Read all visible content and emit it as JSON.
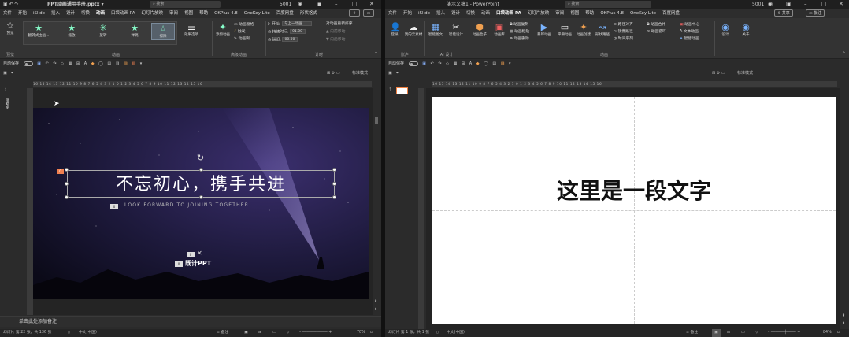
{
  "left": {
    "title": "PPT动画通用手册.pptx ▾",
    "search": "搜索",
    "user": "5001",
    "tabs": [
      "文件",
      "开始",
      "iSlide",
      "插入",
      "设计",
      "切换",
      "动画",
      "口袋动画 PA",
      "幻灯片放映",
      "审阅",
      "视图",
      "帮助",
      "OKPlus 4.8",
      "OneKey Lite",
      "百度网盘",
      "形状格式"
    ],
    "active_tab": 6,
    "ribbon": {
      "preview": "预览",
      "preview_group": "预览",
      "effects": [
        "翻转式由远...",
        "缩放",
        "旋转",
        "弹跳",
        "擦除"
      ],
      "effect_options": "效果选项",
      "anim_group": "动画",
      "add_anim": "添加动画",
      "anim_pane": "动画窗格",
      "trigger": "触发",
      "anim_brush": "动画刷",
      "adv_group": "高级动画",
      "start_label": "开始:",
      "start_value": "与上一动画...",
      "duration_label": "持续时间:",
      "duration_value": "01.00",
      "delay_label": "延迟:",
      "delay_value": "00.00",
      "reorder": "对动画重新排序",
      "move_earlier": "向前移动",
      "move_later": "向后移动",
      "timing_group": "计时"
    },
    "autosave": "自动保存",
    "ruler_text": "16  15  14  13  12  11  10  9  8  7  6  5  4  3  2  1  0  1  2  3  4  5  6  7  8  9  10  11  12  13  14  15  16",
    "view_label": "标准模式",
    "slide": {
      "title": "不忘初心，携手共进",
      "subtitle": "LOOK FORWARD TO JOINING TOGETHER",
      "logo": "既计PPT",
      "bg_color": "#1d1a3a"
    },
    "notes": "单击此处添加备注",
    "status": "幻灯片 第 22 张，共 136 张",
    "lang": "中文(中国)",
    "notes_btn": "备注",
    "zoom": "70%"
  },
  "right": {
    "title": "演示文稿1 - PowerPoint",
    "search": "搜索",
    "user": "5001",
    "share": "共享",
    "comment": "批注",
    "tabs": [
      "文件",
      "开始",
      "iSlide",
      "插入",
      "设计",
      "切换",
      "动画",
      "口袋动画 PA",
      "幻灯片放映",
      "审阅",
      "视图",
      "帮助",
      "OKPlus 4.8",
      "OneKey Lite",
      "百度网盘"
    ],
    "active_tab": 7,
    "ribbon": {
      "login": "登录",
      "cloud": "我的云素材",
      "account_group": "账户",
      "smart_fit": "智能图文",
      "smart_design": "智能设计",
      "ai_group": "AI 设计",
      "anim_box": "动画盒子",
      "anim_lib": "动画库",
      "anim_copy": "动画复制",
      "anim_paste": "动画粘贴",
      "anim_delete": "动画删除",
      "show_anim": "暴郎动画",
      "smooth_anim": "平滑动画",
      "anim_create": "动画创建",
      "path": "形状路径",
      "align": "路径对齐",
      "path_reverse": "镜像路径",
      "time_seq": "时间序列",
      "anim_combine": "动画合并",
      "anim_loop": "动画循环",
      "anim_center": "动画中心",
      "text_anim": "文本动画",
      "smart_anim": "智能动画",
      "anim_group": "动画",
      "design": "设计",
      "about": "关于"
    },
    "autosave": "自动保存",
    "ruler_text": "16  15  14  13  12  11  10  9  8  7  6  5  4  3  2  1  0  1  2  3  4  5  6  7  8  9  10  11  12  13  14  15  16",
    "view_label": "标准模式",
    "slide_num": "1",
    "slide": {
      "text": "这里是一段文字"
    },
    "status": "幻灯片 第 1 张，共 1 张",
    "lang": "中文(中国)",
    "notes_btn": "备注",
    "zoom": "84%"
  }
}
